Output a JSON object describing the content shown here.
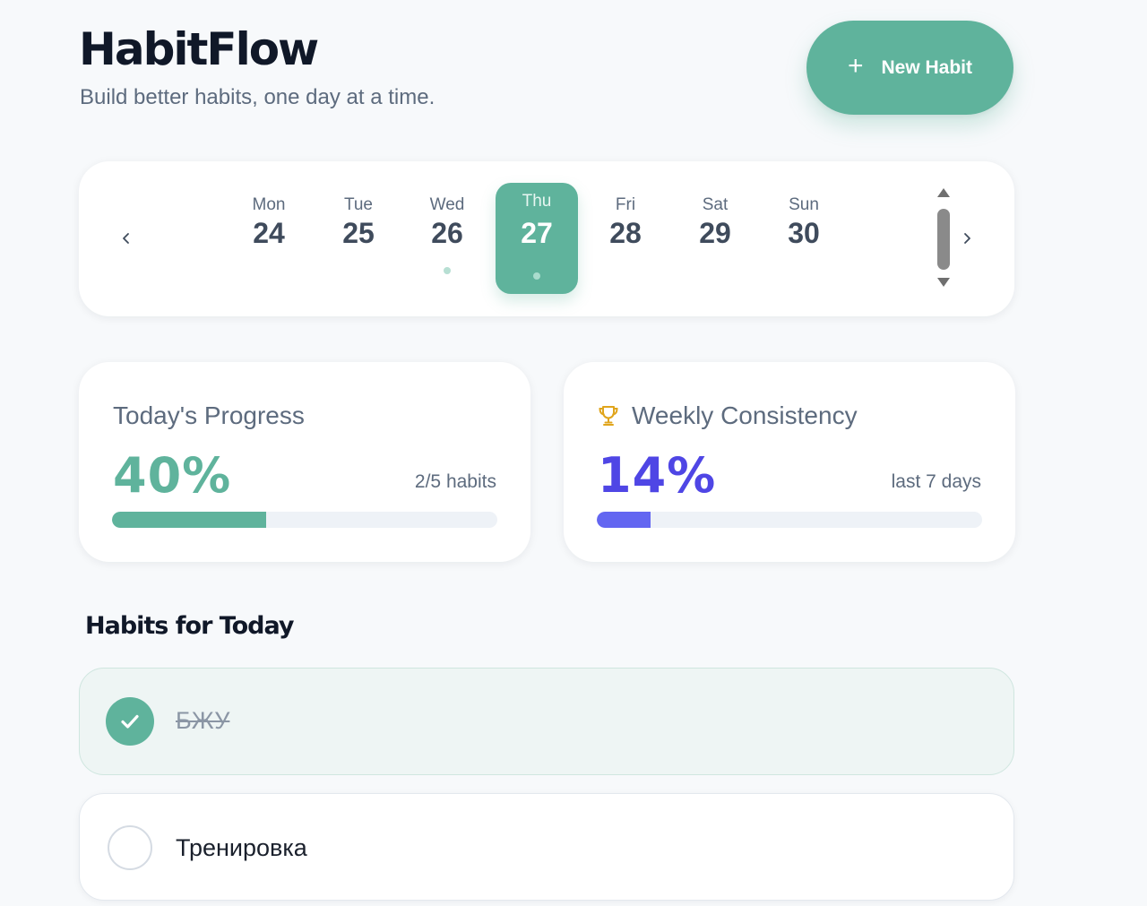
{
  "app": {
    "title": "HabitFlow",
    "subtitle": "Build better habits, one day at a time."
  },
  "header": {
    "new_habit_label": "New Habit",
    "new_habit_icon": "plus-icon"
  },
  "calendar": {
    "prev_icon": "chevron-left-icon",
    "next_icon": "chevron-right-icon",
    "days": [
      {
        "name": "Mon",
        "num": "24",
        "has_dot": false,
        "active": false
      },
      {
        "name": "Tue",
        "num": "25",
        "has_dot": false,
        "active": false
      },
      {
        "name": "Wed",
        "num": "26",
        "has_dot": true,
        "active": false
      },
      {
        "name": "Thu",
        "num": "27",
        "has_dot": true,
        "active": true
      },
      {
        "name": "Fri",
        "num": "28",
        "has_dot": false,
        "active": false
      },
      {
        "name": "Sat",
        "num": "29",
        "has_dot": false,
        "active": false
      },
      {
        "name": "Sun",
        "num": "30",
        "has_dot": false,
        "active": false
      }
    ]
  },
  "stats": {
    "progress": {
      "title": "Today's Progress",
      "value": "40%",
      "meta": "2/5 habits",
      "fraction": 0.4,
      "color": "#5fb39c"
    },
    "consistency": {
      "title": "Weekly Consistency",
      "icon": "trophy-icon",
      "value": "14%",
      "meta": "last 7 days",
      "fraction": 0.14,
      "color": "#6366f1"
    }
  },
  "habits": {
    "section_title": "Habits for Today",
    "items": [
      {
        "name": "БЖУ",
        "done": true
      },
      {
        "name": "Тренировка",
        "done": false
      }
    ]
  },
  "colors": {
    "accent": "#5fb39c",
    "consistency": "#4f46e5",
    "background": "#f7f9fb"
  }
}
